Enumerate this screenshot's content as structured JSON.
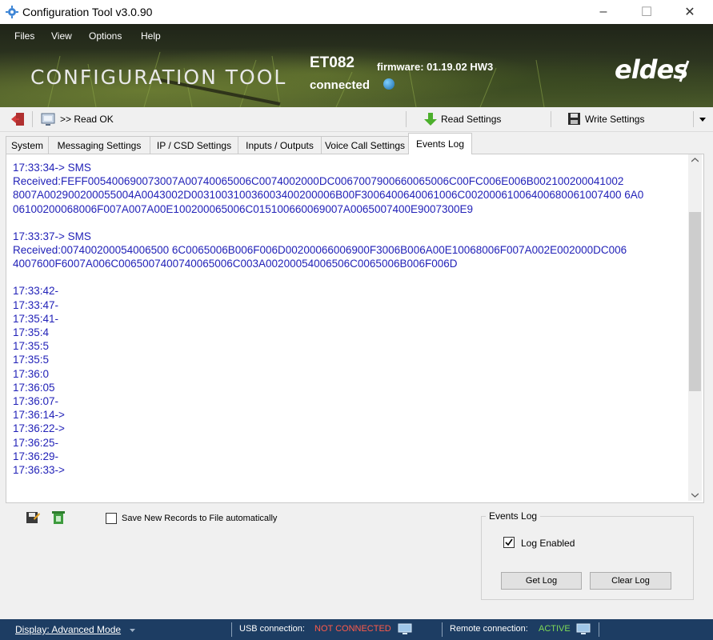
{
  "window": {
    "title": "Configuration Tool v3.0.90",
    "minimize": "–",
    "maximize": "☐",
    "close": "✕"
  },
  "menu": [
    "Files",
    "View",
    "Options",
    "Help"
  ],
  "banner": {
    "app_title": "CONFIGURATION TOOL",
    "model": "ET082",
    "firmware": "firmware: 01.19.02 HW3",
    "status": "connected",
    "logo": "eldes"
  },
  "toolbar": {
    "status": ">> Read OK",
    "read_settings": "Read Settings",
    "write_settings": "Write Settings"
  },
  "tabs": [
    "System",
    "Messaging Settings",
    "IP / CSD Settings",
    "Inputs / Outputs",
    "Voice Call Settings",
    "Events Log"
  ],
  "log": {
    "entry1_head": "17:33:34->  SMS",
    "entry1_body": "Received:FEFF005400690073007A00740065006C0074002000DC0067007900660065006C00FC006E006B00210020004100 28007A002900200055004A0043002D003100310036003400200006B00F30064006400610 06C002000610064006800610074006A0 06100200068006F007A007A00E100200065006C015100660069007A0065007400E9007300E9",
    "entry2_head": "17:33:37->  SMS",
    "entry2_body": "Received:007400200054006500 6C0065006B006F006D00200066006900F3006B006A00E10068006F007A002E002000DC006 4007600F6007A006C0065007400740065006C003A00200054006506C0065006B006F006D",
    "entry1_line1": "17:33:34->  SMS",
    "entry1_line2": "Received:FEFF005400690073007A00740065006C0074002000DC0067007900660065006C00FC006E006B002100200041002",
    "entry1_line3": "8007A002900200055004A0043002D003100310036003400200006B00F3006400640061006C00200061006400680061007400 6A0",
    "entry1_line4": "06100200068006F007A007A00E100200065006C015100660069007A0065007400E9007300E9",
    "entry2_line1": "17:33:37->  SMS",
    "entry2_line2": "Received:007400200054006500 6C0065006B006F006D00200066006900F3006B006A00E10068006F007A002E002000DC006",
    "entry2_line3": "4007600F6007A006C0065007400740065006C003A00200054006506C0065006B006F006D",
    "times": [
      "17:33:42-",
      "17:33:47-",
      "17:35:41-",
      "17:35:4",
      "17:35:5",
      "17:35:5",
      "17:36:0",
      "17:36:05",
      "17:36:07-",
      "17:36:14->",
      "17:36:22->",
      "17:36:25-",
      "17:36:29-",
      "17:36:33->"
    ]
  },
  "bottom": {
    "autosave_label": "Save New Records to File automatically",
    "group_title": "Events Log",
    "log_enabled_label": "Log Enabled",
    "log_enabled": true,
    "get_log": "Get Log",
    "clear_log": "Clear Log"
  },
  "statusbar": {
    "display_mode": "Display: Advanced Mode",
    "usb_label": "USB connection:",
    "usb_value": "NOT CONNECTED",
    "remote_label": "Remote connection:",
    "remote_value": "ACTIVE"
  },
  "colors": {
    "log_text": "#2222b8",
    "usb_status": "#ff5a4a",
    "remote_status": "#7ed957",
    "statusbar_bg": "#1d3d63"
  }
}
